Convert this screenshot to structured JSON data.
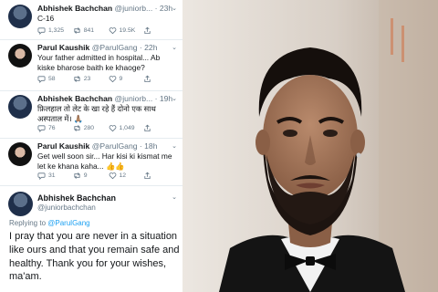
{
  "tweets": [
    {
      "name": "Abhishek Bachchan",
      "handle": "@juniorb...",
      "time": "· 23h",
      "text": "C-16",
      "replies": "1,325",
      "retweets": "841",
      "likes": "19.5K"
    },
    {
      "name": "Parul Kaushik",
      "handle": "@ParulGang · 22h",
      "time": "",
      "text": "Your father admitted in hospital... Ab kiske bharose baith ke khaoge?",
      "replies": "58",
      "retweets": "23",
      "likes": "9"
    },
    {
      "name": "Abhishek Bachchan",
      "handle": "@juniorb...",
      "time": "· 19h",
      "text": "फ़िलहाल तो लेट के खा रहे हैं दोनो एक साथ अस्पताल में। 🙏🏽",
      "replies": "76",
      "retweets": "280",
      "likes": "1,049"
    },
    {
      "name": "Parul Kaushik",
      "handle": "@ParulGang · 18h",
      "time": "",
      "text": "Get well soon sir... Har kisi ki kismat me let ke khana kaha... 👍👍",
      "replies": "31",
      "retweets": "9",
      "likes": "12"
    }
  ],
  "main_tweet": {
    "name": "Abhishek Bachchan",
    "handle": "@juniorbachchan",
    "reply_prefix": "Replying to",
    "reply_handle": "@ParulGang",
    "text": "I pray that you are never in a situation like ours and that you remain safe and healthy. Thank you for your wishes, ma'am."
  },
  "icons": {
    "reply": "reply-icon",
    "retweet": "retweet-icon",
    "like": "heart-icon",
    "share": "share-icon",
    "caret": "chevron-down-icon"
  },
  "colors": {
    "name": "#14171a",
    "secondary": "#657786",
    "link": "#1da1f2",
    "divider": "#e6ecf0"
  }
}
